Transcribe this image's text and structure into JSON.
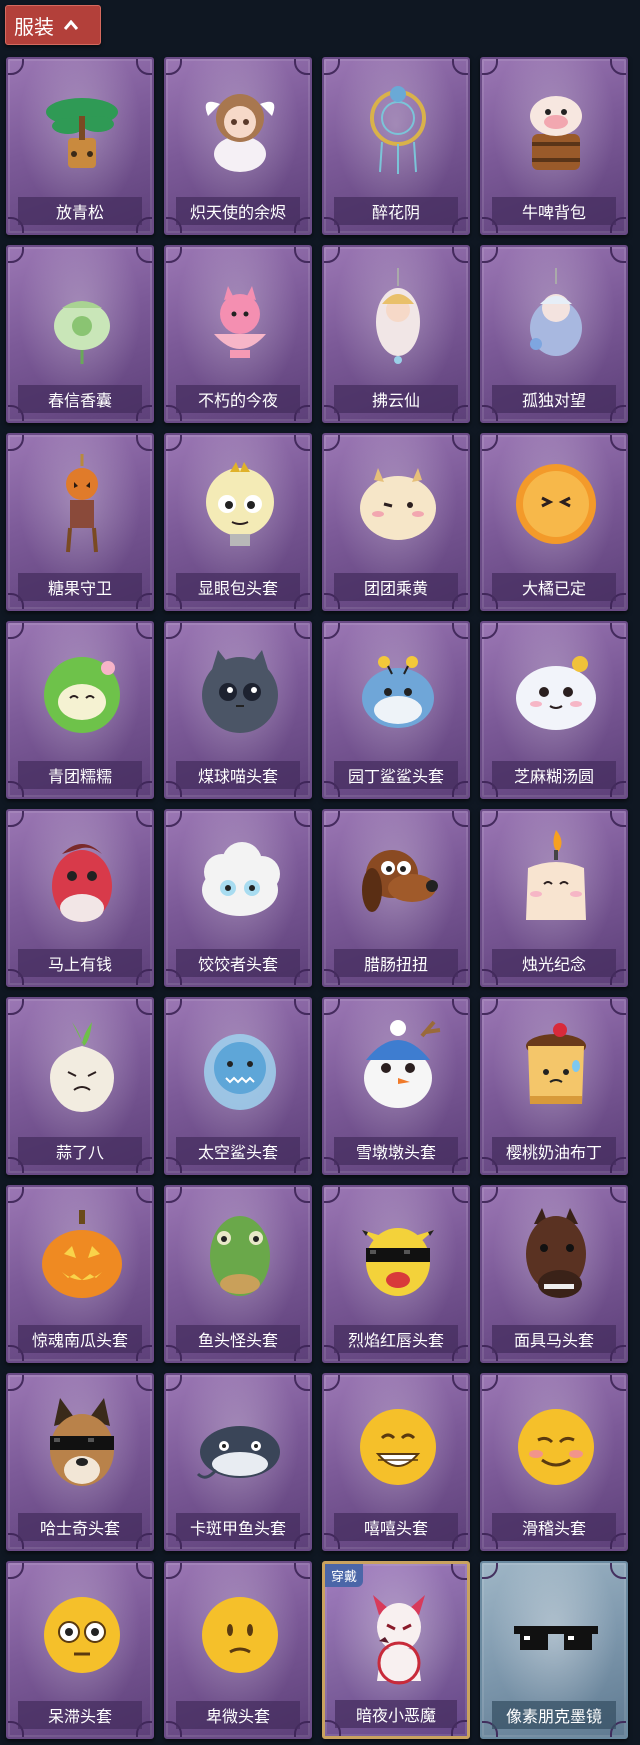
{
  "header": {
    "title": "服装"
  },
  "colors": {
    "background": "#0f1722",
    "header_button": "#b3403a",
    "card_purple": "#7c5a98",
    "card_blue": "#7e98ad",
    "equipped_border": "#c9a25f",
    "equipped_badge": "#4b66a8"
  },
  "items": [
    {
      "label": "放青松",
      "icon": "bonsai-pine-icon",
      "style": "purple"
    },
    {
      "label": "炽天使的余烬",
      "icon": "angel-girl-icon",
      "style": "purple"
    },
    {
      "label": "醉花阴",
      "icon": "dreamcatcher-icon",
      "style": "purple"
    },
    {
      "label": "牛啤背包",
      "icon": "cow-beer-barrel-icon",
      "style": "purple"
    },
    {
      "label": "春信香囊",
      "icon": "sachet-icon",
      "style": "purple"
    },
    {
      "label": "不朽的今夜",
      "icon": "pink-fox-bowl-icon",
      "style": "purple"
    },
    {
      "label": "拂云仙",
      "icon": "immortal-charm-icon",
      "style": "purple"
    },
    {
      "label": "孤独对望",
      "icon": "blue-doll-charm-icon",
      "style": "purple"
    },
    {
      "label": "糖果守卫",
      "icon": "pumpkin-scarecrow-icon",
      "style": "purple"
    },
    {
      "label": "显眼包头套",
      "icon": "lightbulb-head-icon",
      "style": "purple"
    },
    {
      "label": "团团乘黄",
      "icon": "cream-beast-head-icon",
      "style": "purple"
    },
    {
      "label": "大橘已定",
      "icon": "orange-slice-head-icon",
      "style": "purple"
    },
    {
      "label": "青团糯糯",
      "icon": "green-rice-ball-icon",
      "style": "purple"
    },
    {
      "label": "煤球喵头套",
      "icon": "gray-cat-head-icon",
      "style": "purple"
    },
    {
      "label": "园丁鲨鲨头套",
      "icon": "bee-shark-head-icon",
      "style": "purple"
    },
    {
      "label": "芝麻糊汤圆",
      "icon": "white-dumpling-icon",
      "style": "purple"
    },
    {
      "label": "马上有钱",
      "icon": "red-horse-head-icon",
      "style": "purple"
    },
    {
      "label": "饺饺者头套",
      "icon": "cloud-dumpling-head-icon",
      "style": "purple"
    },
    {
      "label": "腊肠扭扭",
      "icon": "dachshund-head-icon",
      "style": "purple"
    },
    {
      "label": "烛光纪念",
      "icon": "candle-head-icon",
      "style": "purple"
    },
    {
      "label": "蒜了八",
      "icon": "garlic-head-icon",
      "style": "purple"
    },
    {
      "label": "太空鲨头套",
      "icon": "space-shark-head-icon",
      "style": "purple"
    },
    {
      "label": "雪墩墩头套",
      "icon": "snowman-head-icon",
      "style": "purple"
    },
    {
      "label": "樱桃奶油布丁",
      "icon": "pudding-head-icon",
      "style": "purple"
    },
    {
      "label": "惊魂南瓜头套",
      "icon": "jack-o-lantern-icon",
      "style": "purple"
    },
    {
      "label": "鱼头怪头套",
      "icon": "fish-head-icon",
      "style": "purple"
    },
    {
      "label": "烈焰红唇头套",
      "icon": "pikachu-sunglasses-head-icon",
      "style": "purple"
    },
    {
      "label": "面具马头套",
      "icon": "horse-mask-icon",
      "style": "purple"
    },
    {
      "label": "哈士奇头套",
      "icon": "husky-sunglasses-head-icon",
      "style": "purple"
    },
    {
      "label": "卡斑甲鱼头套",
      "icon": "catfish-head-icon",
      "style": "purple"
    },
    {
      "label": "嘻嘻头套",
      "icon": "grin-emoji-head-icon",
      "style": "purple"
    },
    {
      "label": "滑稽头套",
      "icon": "smirk-emoji-head-icon",
      "style": "purple"
    },
    {
      "label": "呆滞头套",
      "icon": "stare-emoji-head-icon",
      "style": "purple"
    },
    {
      "label": "卑微头套",
      "icon": "humble-emoji-head-icon",
      "style": "purple"
    },
    {
      "label": "暗夜小恶魔",
      "icon": "little-devil-icon",
      "style": "equipped",
      "badge": "穿戴"
    },
    {
      "label": "像素朋克墨镜",
      "icon": "pixel-sunglasses-icon",
      "style": "blue"
    }
  ]
}
